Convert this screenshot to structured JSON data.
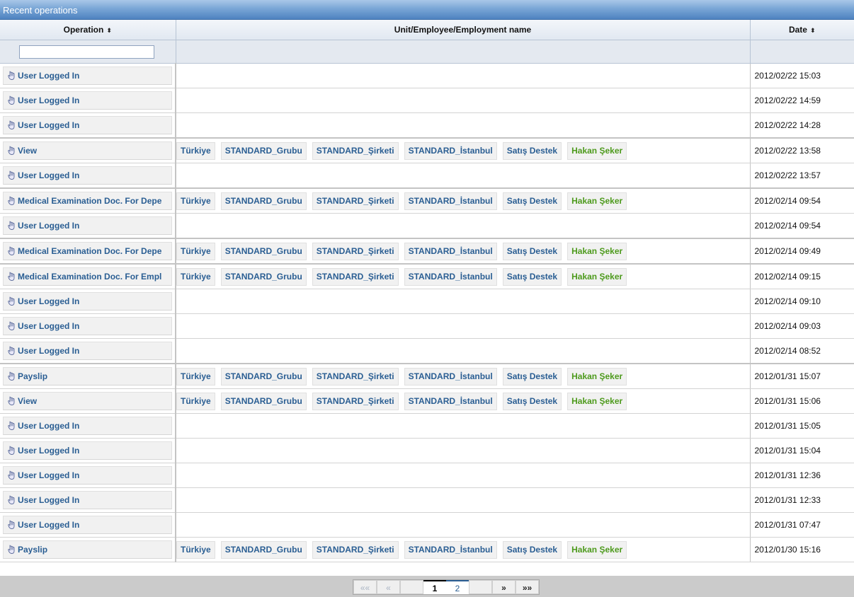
{
  "panel": {
    "title": "Recent operations"
  },
  "columns": {
    "operation": "Operation",
    "unit": "Unit/Employee/Employment name",
    "date": "Date"
  },
  "filter": {
    "operation_value": "",
    "operation_placeholder": ""
  },
  "rows": [
    {
      "operation": "User Logged In",
      "units": [],
      "date": "2012/02/22 15:03"
    },
    {
      "operation": "User Logged In",
      "units": [],
      "date": "2012/02/22 14:59"
    },
    {
      "operation": "User Logged In",
      "units": [],
      "date": "2012/02/22 14:28"
    },
    {
      "operation": "View",
      "units": [
        "Türkiye",
        "STANDARD_Grubu",
        "STANDARD_Şirketi",
        "STANDARD_İstanbul",
        "Satış Destek",
        "Hakan Şeker"
      ],
      "date": "2012/02/22 13:58"
    },
    {
      "operation": "User Logged In",
      "units": [],
      "date": "2012/02/22 13:57"
    },
    {
      "operation": "Medical Examination Doc. For Depe",
      "units": [
        "Türkiye",
        "STANDARD_Grubu",
        "STANDARD_Şirketi",
        "STANDARD_İstanbul",
        "Satış Destek",
        "Hakan Şeker"
      ],
      "date": "2012/02/14 09:54"
    },
    {
      "operation": "User Logged In",
      "units": [],
      "date": "2012/02/14 09:54"
    },
    {
      "operation": "Medical Examination Doc. For Depe",
      "units": [
        "Türkiye",
        "STANDARD_Grubu",
        "STANDARD_Şirketi",
        "STANDARD_İstanbul",
        "Satış Destek",
        "Hakan Şeker"
      ],
      "date": "2012/02/14 09:49"
    },
    {
      "operation": "Medical Examination Doc. For Empl",
      "units": [
        "Türkiye",
        "STANDARD_Grubu",
        "STANDARD_Şirketi",
        "STANDARD_İstanbul",
        "Satış Destek",
        "Hakan Şeker"
      ],
      "date": "2012/02/14 09:15"
    },
    {
      "operation": "User Logged In",
      "units": [],
      "date": "2012/02/14 09:10"
    },
    {
      "operation": "User Logged In",
      "units": [],
      "date": "2012/02/14 09:03"
    },
    {
      "operation": "User Logged In",
      "units": [],
      "date": "2012/02/14 08:52"
    },
    {
      "operation": "Payslip",
      "units": [
        "Türkiye",
        "STANDARD_Grubu",
        "STANDARD_Şirketi",
        "STANDARD_İstanbul",
        "Satış Destek",
        "Hakan Şeker"
      ],
      "date": "2012/01/31 15:07"
    },
    {
      "operation": "View",
      "units": [
        "Türkiye",
        "STANDARD_Grubu",
        "STANDARD_Şirketi",
        "STANDARD_İstanbul",
        "Satış Destek",
        "Hakan Şeker"
      ],
      "date": "2012/01/31 15:06"
    },
    {
      "operation": "User Logged In",
      "units": [],
      "date": "2012/01/31 15:05"
    },
    {
      "operation": "User Logged In",
      "units": [],
      "date": "2012/01/31 15:04"
    },
    {
      "operation": "User Logged In",
      "units": [],
      "date": "2012/01/31 12:36"
    },
    {
      "operation": "User Logged In",
      "units": [],
      "date": "2012/01/31 12:33"
    },
    {
      "operation": "User Logged In",
      "units": [],
      "date": "2012/01/31 07:47"
    },
    {
      "operation": "Payslip",
      "units": [
        "Türkiye",
        "STANDARD_Grubu",
        "STANDARD_Şirketi",
        "STANDARD_İstanbul",
        "Satış Destek",
        "Hakan Şeker"
      ],
      "date": "2012/01/30 15:16"
    }
  ],
  "pager": {
    "first": "««",
    "prev": "«",
    "pages": [
      "1",
      "2"
    ],
    "current_page": "1",
    "next": "»",
    "last": "»»"
  },
  "icons": {
    "operation": "hand-icon",
    "sort": "sort-arrows-icon"
  },
  "colors": {
    "link": "#2a5e93",
    "employee": "#4d9a1c",
    "header_gradient_bottom": "#4e82c0"
  }
}
